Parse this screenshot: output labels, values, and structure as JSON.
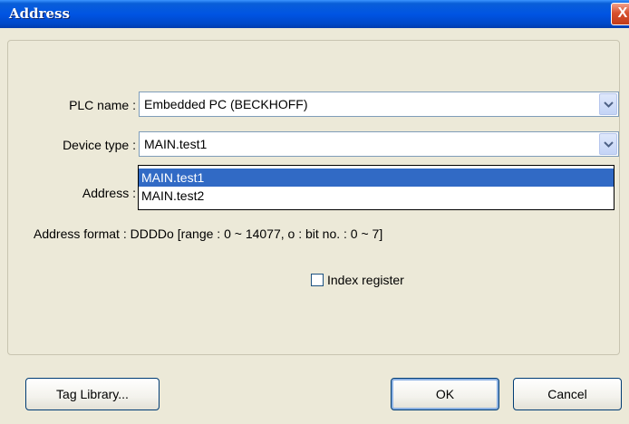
{
  "window": {
    "title": "Address",
    "close_glyph": "X"
  },
  "form": {
    "plc_name_label": "PLC name :",
    "plc_name_value": "Embedded PC (BECKHOFF)",
    "device_type_label": "Device type :",
    "device_type_value": "MAIN.test1",
    "device_type_options": [
      "MAIN.test1",
      "MAIN.test2"
    ],
    "address_label": "Address :",
    "address_format": "Address format : DDDDo [range : 0 ~ 14077, o : bit no. : 0 ~ 7]",
    "index_register_label": "Index register",
    "index_register_checked": false
  },
  "buttons": {
    "tag_library": "Tag Library...",
    "ok": "OK",
    "cancel": "Cancel"
  },
  "icons": {
    "close": "close-icon",
    "dropdown": "chevron-down-icon"
  }
}
